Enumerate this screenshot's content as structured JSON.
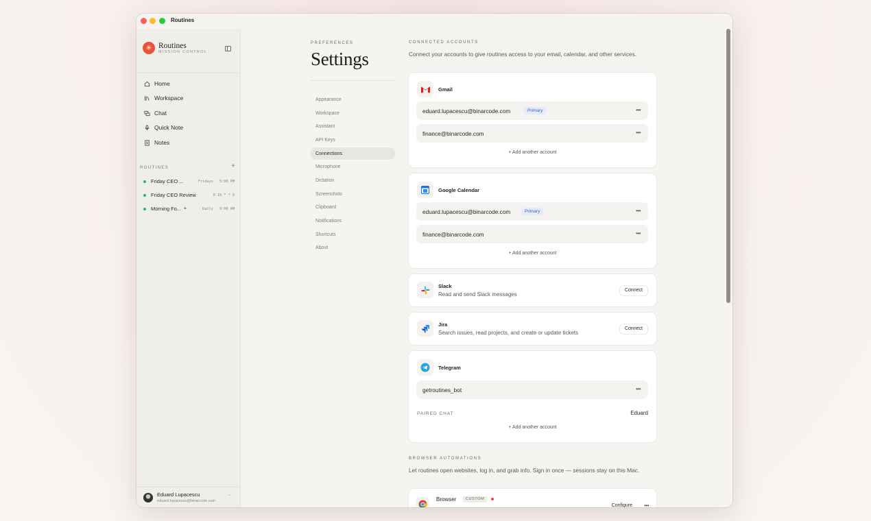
{
  "window": {
    "title": "Routines"
  },
  "sidebar": {
    "brand_name": "Routines",
    "brand_sub": "MISSION CONTROL",
    "nav": [
      {
        "label": "Home",
        "icon": "home-icon"
      },
      {
        "label": "Workspace",
        "icon": "library-icon"
      },
      {
        "label": "Chat",
        "icon": "chat-icon"
      },
      {
        "label": "Quick Note",
        "icon": "microphone-icon"
      },
      {
        "label": "Notes",
        "icon": "document-icon"
      }
    ],
    "routines_label": "ROUTINES",
    "routines": [
      {
        "name": "Friday CEO ...",
        "schedule": "Fridays · 5:00 PM",
        "status_color": "#22b573"
      },
      {
        "name": "Friday CEO Review",
        "schedule": "0 16 * * 5",
        "status_color": "#22b573"
      },
      {
        "name": "Morning Fo...",
        "schedule": "Daily · 9:00 AM",
        "status_color": "#22b573"
      }
    ],
    "user": {
      "name": "Eduard Lupacescu",
      "email": "eduard.lupacescu@binarcode.com"
    }
  },
  "settings": {
    "eyebrow": "PREFERENCES",
    "title": "Settings",
    "menu": [
      "Appearance",
      "Workspace",
      "Assistant",
      "API Keys",
      "Connections",
      "Microphone",
      "Dictation",
      "Screenshots",
      "Clipboard",
      "Notifications",
      "Shortcuts",
      "About"
    ],
    "active": "Connections"
  },
  "connected": {
    "label": "CONNECTED ACCOUNTS",
    "desc": "Connect your accounts to give routines access to your email, calendar, and other services.",
    "add_label": "Add another account",
    "gmail": {
      "name": "Gmail",
      "accounts": [
        {
          "email": "eduard.lupacescu@binarcode.com",
          "badge": "Primary"
        },
        {
          "email": "finance@binarcode.com"
        }
      ]
    },
    "gcal": {
      "name": "Google Calendar",
      "accounts": [
        {
          "email": "eduard.lupacescu@binarcode.com",
          "badge": "Primary"
        },
        {
          "email": "finance@binarcode.com"
        }
      ]
    },
    "slack": {
      "name": "Slack",
      "desc": "Read and send Slack messages",
      "button": "Connect"
    },
    "jira": {
      "name": "Jira",
      "desc": "Search issues, read projects, and create or update tickets",
      "button": "Connect"
    },
    "telegram": {
      "name": "Telegram",
      "accounts": [
        {
          "email": "getroutines_bot"
        }
      ],
      "paired_label": "PAIRED CHAT",
      "paired_value": "Eduard"
    }
  },
  "browser": {
    "label": "BROWSER AUTOMATIONS",
    "desc": "Let routines open websites, log in, and grab info. Sign in once — sessions stay on this Mac.",
    "name": "Browser",
    "badge": "CUSTOM",
    "button": "Configure"
  },
  "colors": {
    "accent": "#e8533a",
    "status_green": "#22b573",
    "primary_badge": "#3b63b8"
  }
}
